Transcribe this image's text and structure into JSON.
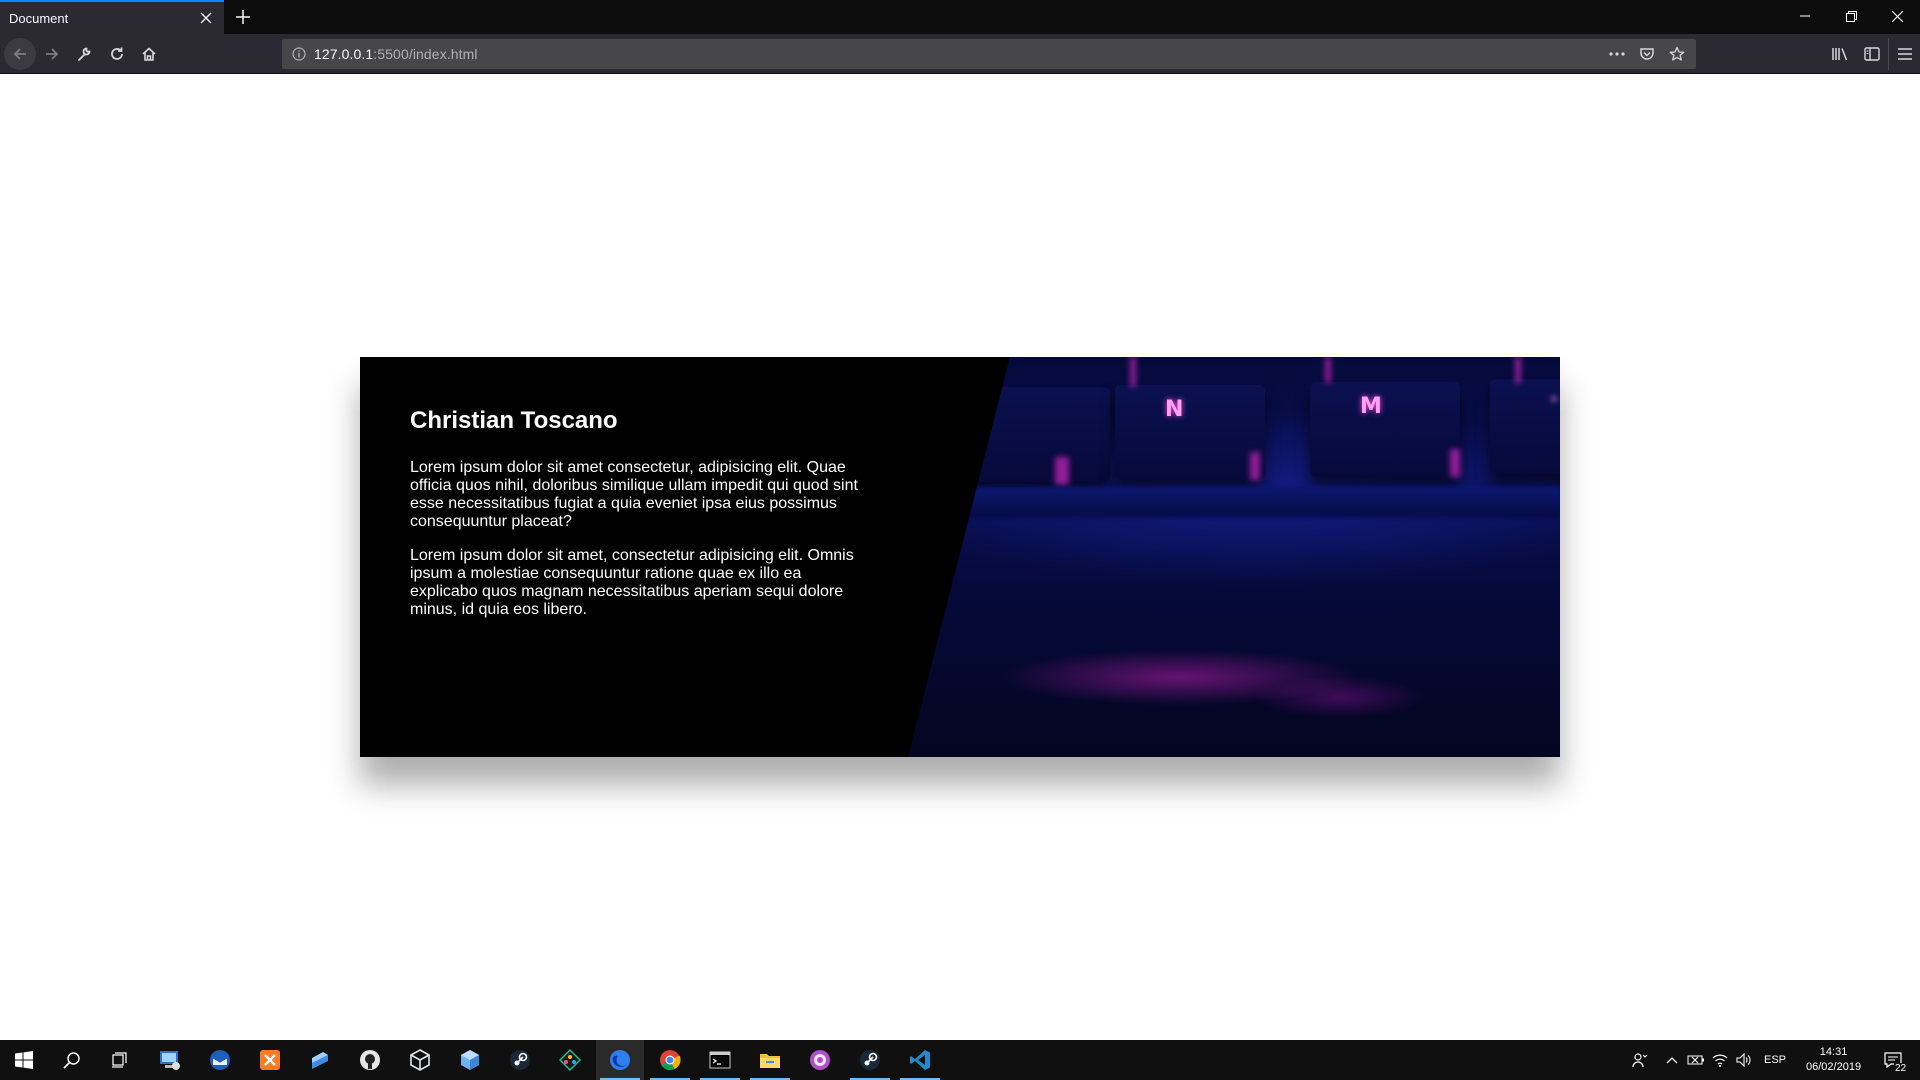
{
  "browser": {
    "tab": {
      "title": "Document"
    },
    "url": {
      "host": "127.0.0.1",
      "rest": ":5500/index.html"
    }
  },
  "card": {
    "title": "Christian Toscano",
    "paragraphs": [
      "Lorem ipsum dolor sit amet consectetur, adipisicing elit. Quae officia quos nihil, doloribus similique ullam impedit qui quod sint esse necessitatibus fugiat a quia eveniet ipsa eius possimus consequuntur placeat?",
      "Lorem ipsum dolor sit amet, consectetur adipisicing elit. Omnis ipsum a molestiae consequuntur ratione quae ex illo ea explicabo quos magnam necessitatibus aperiam sequi dolore minus, id quia eos libero."
    ],
    "key_legends": [
      "N",
      "M"
    ]
  },
  "taskbar": {
    "apps": [
      "start",
      "search",
      "task-view",
      "computer-management",
      "thunderbird",
      "xampp",
      "remote-desktop",
      "github",
      "virtualbox",
      "3d-viewer",
      "steam",
      "gitkraken",
      "firefox",
      "chrome",
      "terminal",
      "file-explorer",
      "pink-app",
      "steam-2",
      "vscode"
    ],
    "language": "ESP",
    "time": "14:31",
    "date": "06/02/2019",
    "notifications": "22"
  },
  "colors": {
    "accent": "#0a84ff",
    "chrome_dark": "#0c0c0d",
    "toolbar": "#2b2a33",
    "taskbar": "#101010",
    "taskbar_indicator": "#76b9ed"
  }
}
